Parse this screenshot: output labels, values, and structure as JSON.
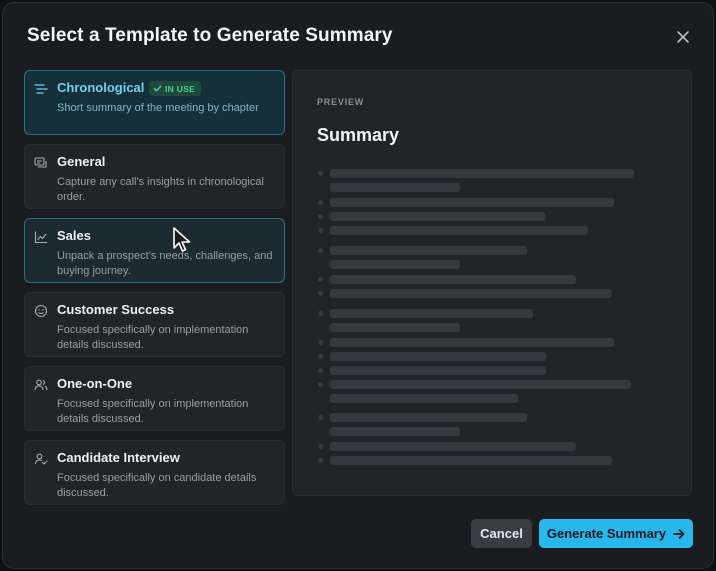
{
  "dialog": {
    "title": "Select a Template to Generate Summary"
  },
  "templates": [
    {
      "name": "Chronological",
      "description": "Short summary of the meeting by chapter",
      "badge": "IN USE",
      "icon": "list-lines-icon"
    },
    {
      "name": "General",
      "description": "Capture any call's insights in chronological order.",
      "icon": "chat-bubbles-icon"
    },
    {
      "name": "Sales",
      "description": "Unpack a prospect's needs, challenges, and buying journey.",
      "icon": "chart-line-icon"
    },
    {
      "name": "Customer Success",
      "description": "Focused specifically on implementation details discussed.",
      "icon": "smiley-icon"
    },
    {
      "name": "One-on-One",
      "description": "Focused specifically on implementation details discussed.",
      "icon": "users-icon"
    },
    {
      "name": "Candidate Interview",
      "description": "Focused specifically on candidate details discussed.",
      "icon": "user-check-icon"
    }
  ],
  "preview": {
    "label": "PREVIEW",
    "title": "Summary"
  },
  "footer": {
    "cancel_label": "Cancel",
    "generate_label": "Generate Summary"
  },
  "colors": {
    "accent": "#27b7ea",
    "active_text": "#6fd3f0",
    "badge_text": "#4fd08f",
    "background": "#1b1c1f"
  }
}
